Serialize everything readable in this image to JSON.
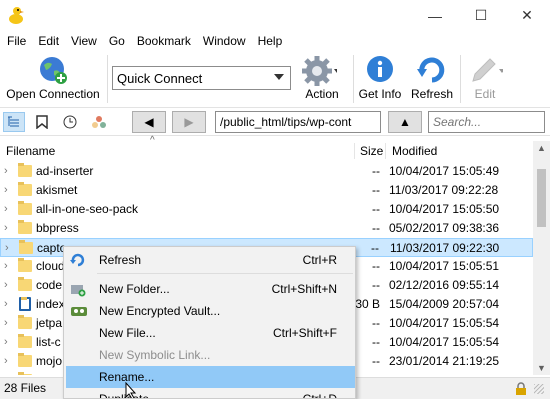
{
  "window": {
    "minimize": "—",
    "maximize": "☐",
    "close": "✕"
  },
  "menu": [
    "File",
    "Edit",
    "View",
    "Go",
    "Bookmark",
    "Window",
    "Help"
  ],
  "toolbar": {
    "open_connection": "Open Connection",
    "quick_connect": "Quick Connect",
    "action": "Action",
    "get_info": "Get Info",
    "refresh": "Refresh",
    "edit": "Edit"
  },
  "navbar": {
    "path": "/public_html/tips/wp-cont",
    "search_placeholder": "Search...",
    "back": "◀",
    "forward": "▶",
    "up": "▲"
  },
  "columns": {
    "filename": "Filename",
    "size": "Size",
    "modified": "Modified"
  },
  "files": [
    {
      "name": "ad-inserter",
      "size": "--",
      "modified": "10/04/2017 15:05:49",
      "type": "folder"
    },
    {
      "name": "akismet",
      "size": "--",
      "modified": "11/03/2017 09:22:28",
      "type": "folder"
    },
    {
      "name": "all-in-one-seo-pack",
      "size": "--",
      "modified": "10/04/2017 15:05:50",
      "type": "folder"
    },
    {
      "name": "bbpress",
      "size": "--",
      "modified": "05/02/2017 09:38:36",
      "type": "folder"
    },
    {
      "name": "captc",
      "size": "--",
      "modified": "11/03/2017 09:22:30",
      "type": "folder",
      "selected": true
    },
    {
      "name": "cloud",
      "size": "--",
      "modified": "10/04/2017 15:05:51",
      "type": "folder"
    },
    {
      "name": "code",
      "size": "--",
      "modified": "02/12/2016 09:55:14",
      "type": "folder"
    },
    {
      "name": "index",
      "size": "30 B",
      "modified": "15/04/2009 20:57:04",
      "type": "file"
    },
    {
      "name": "jetpa",
      "size": "--",
      "modified": "10/04/2017 15:05:54",
      "type": "folder"
    },
    {
      "name": "list-c",
      "size": "--",
      "modified": "10/04/2017 15:05:54",
      "type": "folder"
    },
    {
      "name": "mojo",
      "size": "--",
      "modified": "23/01/2014 21:19:25",
      "type": "folder"
    },
    {
      "name": "",
      "size": "--",
      "modified": "10/04/2017 15:05:54",
      "type": "folder"
    }
  ],
  "status": {
    "count": "28 Files"
  },
  "context_menu": [
    {
      "label": "Refresh",
      "shortcut": "Ctrl+R",
      "icon": "refresh-icon"
    },
    {
      "label": "New Folder...",
      "shortcut": "Ctrl+Shift+N",
      "icon": "new-folder-icon"
    },
    {
      "label": "New Encrypted Vault...",
      "shortcut": "",
      "icon": "vault-icon"
    },
    {
      "label": "New File...",
      "shortcut": "Ctrl+Shift+F",
      "icon": ""
    },
    {
      "label": "New Symbolic Link...",
      "shortcut": "",
      "icon": "",
      "disabled": true
    },
    {
      "label": "Rename...",
      "shortcut": "",
      "icon": "",
      "highlighted": true
    },
    {
      "label": "Duplicate...",
      "shortcut": "Ctrl+D",
      "icon": ""
    }
  ],
  "colors": {
    "selection": "#cce8ff",
    "menu_highlight": "#91c9f7",
    "folder": "#f8d775"
  }
}
